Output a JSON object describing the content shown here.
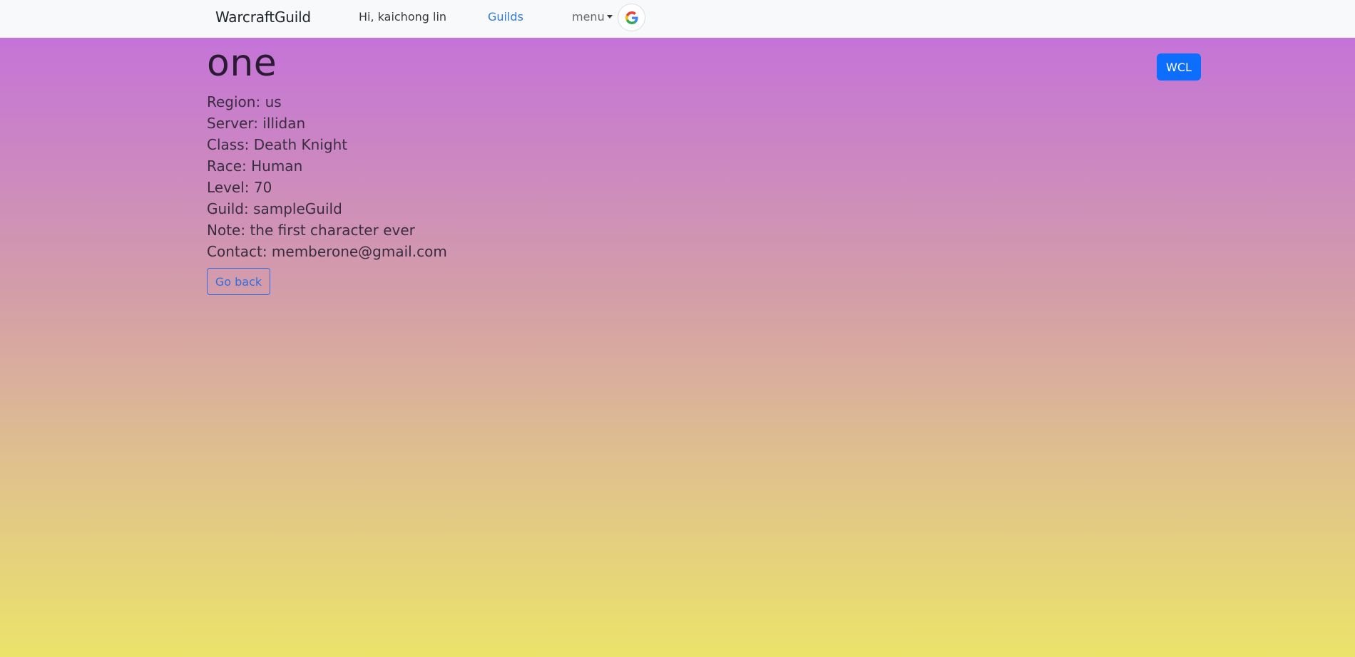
{
  "navbar": {
    "brand": "WarcraftGuild",
    "greeting": "Hi, kaichong lin",
    "guilds_link": "Guilds",
    "menu_label": "menu",
    "google_icon": "google-icon"
  },
  "character": {
    "name": "one",
    "wcl_button": "WCL",
    "fields": [
      "Region: us",
      "Server: illidan",
      "Class: Death Knight",
      "Race: Human",
      "Level: 70",
      "Guild: sampleGuild",
      "Note: the first character ever",
      "Contact: memberone@gmail.com"
    ],
    "back_button": "Go back"
  },
  "colors": {
    "link": "#2f7ad6",
    "primary": "#0d6efd",
    "gradient_top": "#c26ddf",
    "gradient_bottom": "#ebe36a"
  }
}
